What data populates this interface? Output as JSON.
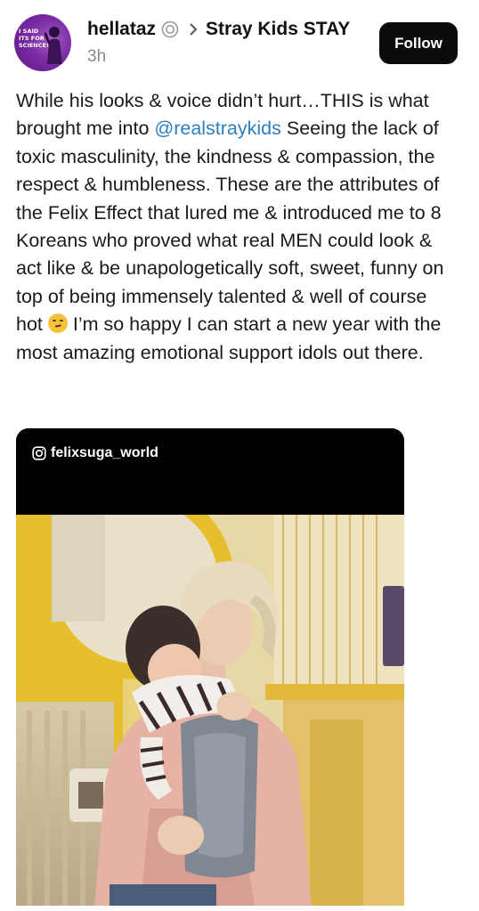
{
  "header": {
    "avatar_text": "I SAID\nITS FOR\nSCIENCE!",
    "username": "hellataz",
    "community": "Stray Kids STAY",
    "time": "3h",
    "follow_label": "Follow"
  },
  "post": {
    "text_part1": "While his looks & voice didn’t hurt…THIS is what brought me into ",
    "mention": "@realstraykids",
    "text_part2": " Seeing the lack of toxic masculinity, the kindness & compassion, the respect & humbleness. These are the attributes of the Felix Effect that lured me & introduced me to 8 Koreans who proved what real MEN could look & act like & be unapologetically soft, sweet, funny on top of being immensely talented & well of course hot ",
    "emoji_name": "smirking-face-emoji",
    "text_part3": " I’m so happy I can start a new year with the most amazing emotional support idols out there."
  },
  "media": {
    "source_handle": "felixsuga_world",
    "icon": "instagram-icon"
  },
  "colors": {
    "accent_link": "#2c7fc1",
    "button_bg": "#0b0b0b",
    "avatar_purple": "#7b2aa3"
  }
}
